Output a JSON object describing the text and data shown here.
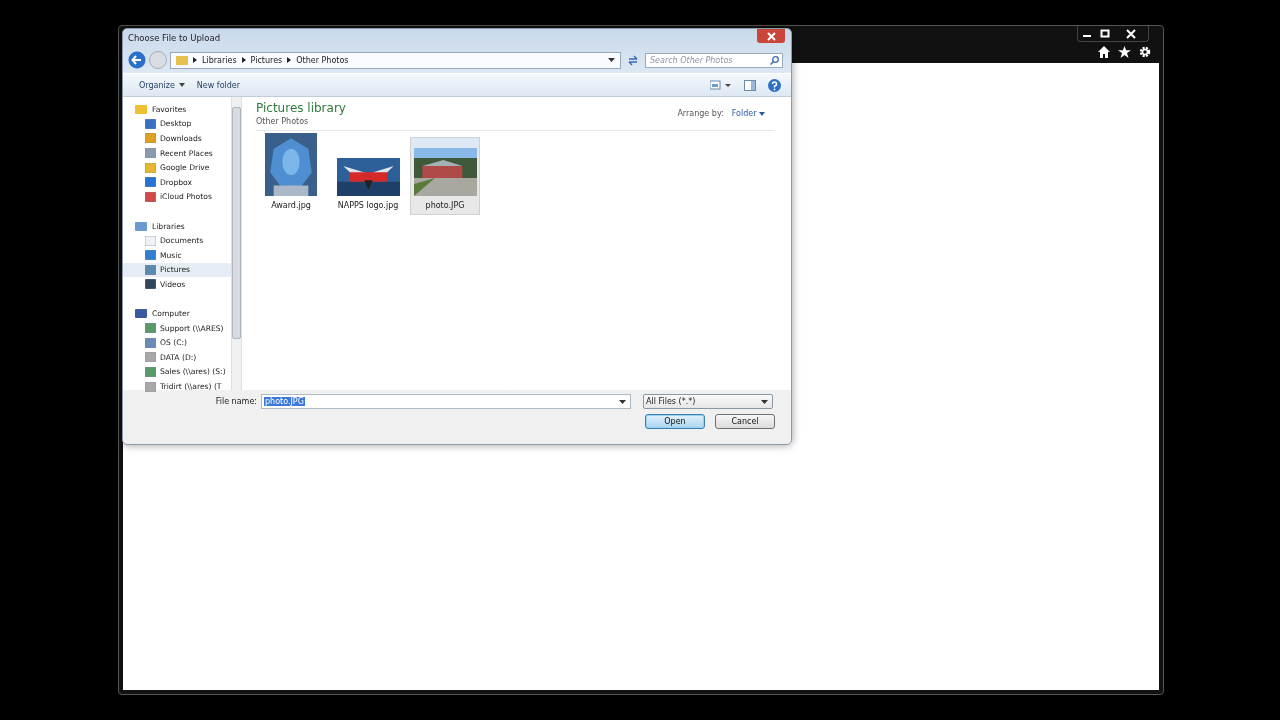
{
  "dialog": {
    "title": "Choose File to Upload",
    "breadcrumbs": [
      "Libraries",
      "Pictures",
      "Other Photos"
    ],
    "search": {
      "placeholder": "Search Other Photos"
    },
    "toolbar": [
      {
        "label": "Organize",
        "has_menu": true
      },
      {
        "label": "New folder",
        "has_menu": false
      }
    ],
    "nav": [
      {
        "label": "Favorites",
        "children": [
          {
            "label": "Desktop",
            "selected": false
          },
          {
            "label": "Downloads",
            "selected": false
          },
          {
            "label": "Recent Places",
            "selected": false
          },
          {
            "label": "Google Drive",
            "selected": false
          },
          {
            "label": "Dropbox",
            "selected": false
          },
          {
            "label": "iCloud Photos",
            "selected": false
          }
        ]
      },
      {
        "label": "Libraries",
        "children": [
          {
            "label": "Documents",
            "selected": false
          },
          {
            "label": "Music",
            "selected": false
          },
          {
            "label": "Pictures",
            "selected": true
          },
          {
            "label": "Videos",
            "selected": false
          }
        ]
      },
      {
        "label": "Computer",
        "children": [
          {
            "label": "Support (\\\\ARES)",
            "selected": false
          },
          {
            "label": "OS (C:)",
            "selected": false
          },
          {
            "label": "DATA (D:)",
            "selected": false
          },
          {
            "label": "Sales (\\\\ares) (S:)",
            "selected": false
          },
          {
            "label": "Tridirt (\\\\ares) (T",
            "selected": false
          }
        ]
      }
    ],
    "library": {
      "title": "Pictures library",
      "subtitle": "Other Photos",
      "arrange_label": "Arrange by:",
      "arrange_value": "Folder"
    },
    "files": [
      {
        "name": "Award.jpg",
        "selected": false,
        "kind": "picture"
      },
      {
        "name": "NAPPS logo.jpg",
        "selected": false,
        "kind": "picture"
      },
      {
        "name": "photo.JPG",
        "selected": true,
        "kind": "picture"
      }
    ],
    "file_name": {
      "label": "File name:",
      "value": "photo.JPG",
      "text_selected": true
    },
    "filter": "All Files (*.*)",
    "buttons": [
      {
        "label": "Open",
        "default": true
      },
      {
        "label": "Cancel",
        "default": false
      }
    ]
  }
}
